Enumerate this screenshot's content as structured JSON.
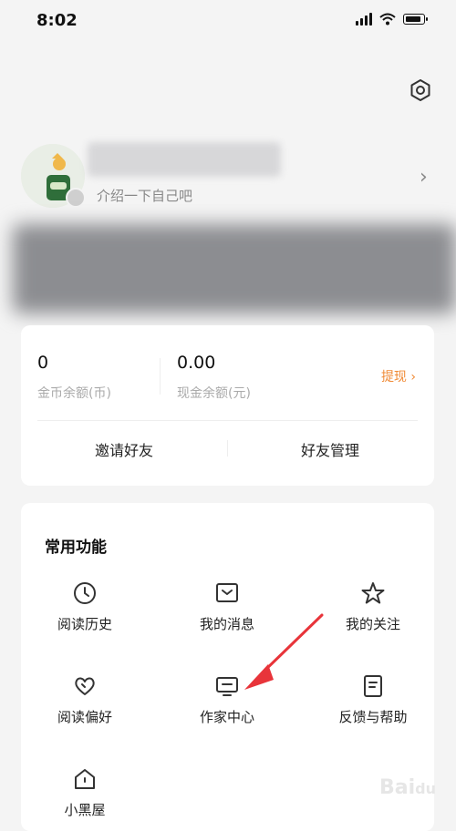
{
  "status_bar": {
    "time": "8:02"
  },
  "profile": {
    "intro": "介绍一下自己吧"
  },
  "wallet": {
    "coin_value": "0",
    "coin_label": "金币余额(币)",
    "cash_value": "0.00",
    "cash_label": "现金余额(元)",
    "withdraw_label": "提现",
    "invite_label": "邀请好友",
    "manage_label": "好友管理"
  },
  "functions": {
    "title": "常用功能",
    "items": [
      {
        "label": "阅读历史",
        "icon": "clock-icon"
      },
      {
        "label": "我的消息",
        "icon": "message-icon"
      },
      {
        "label": "我的关注",
        "icon": "star-icon"
      },
      {
        "label": "阅读偏好",
        "icon": "heart-icon"
      },
      {
        "label": "作家中心",
        "icon": "monitor-icon"
      },
      {
        "label": "反馈与帮助",
        "icon": "document-icon"
      },
      {
        "label": "小黑屋",
        "icon": "house-icon"
      }
    ]
  },
  "colors": {
    "accent": "#f08a35",
    "annotation_arrow": "#e8343a"
  }
}
